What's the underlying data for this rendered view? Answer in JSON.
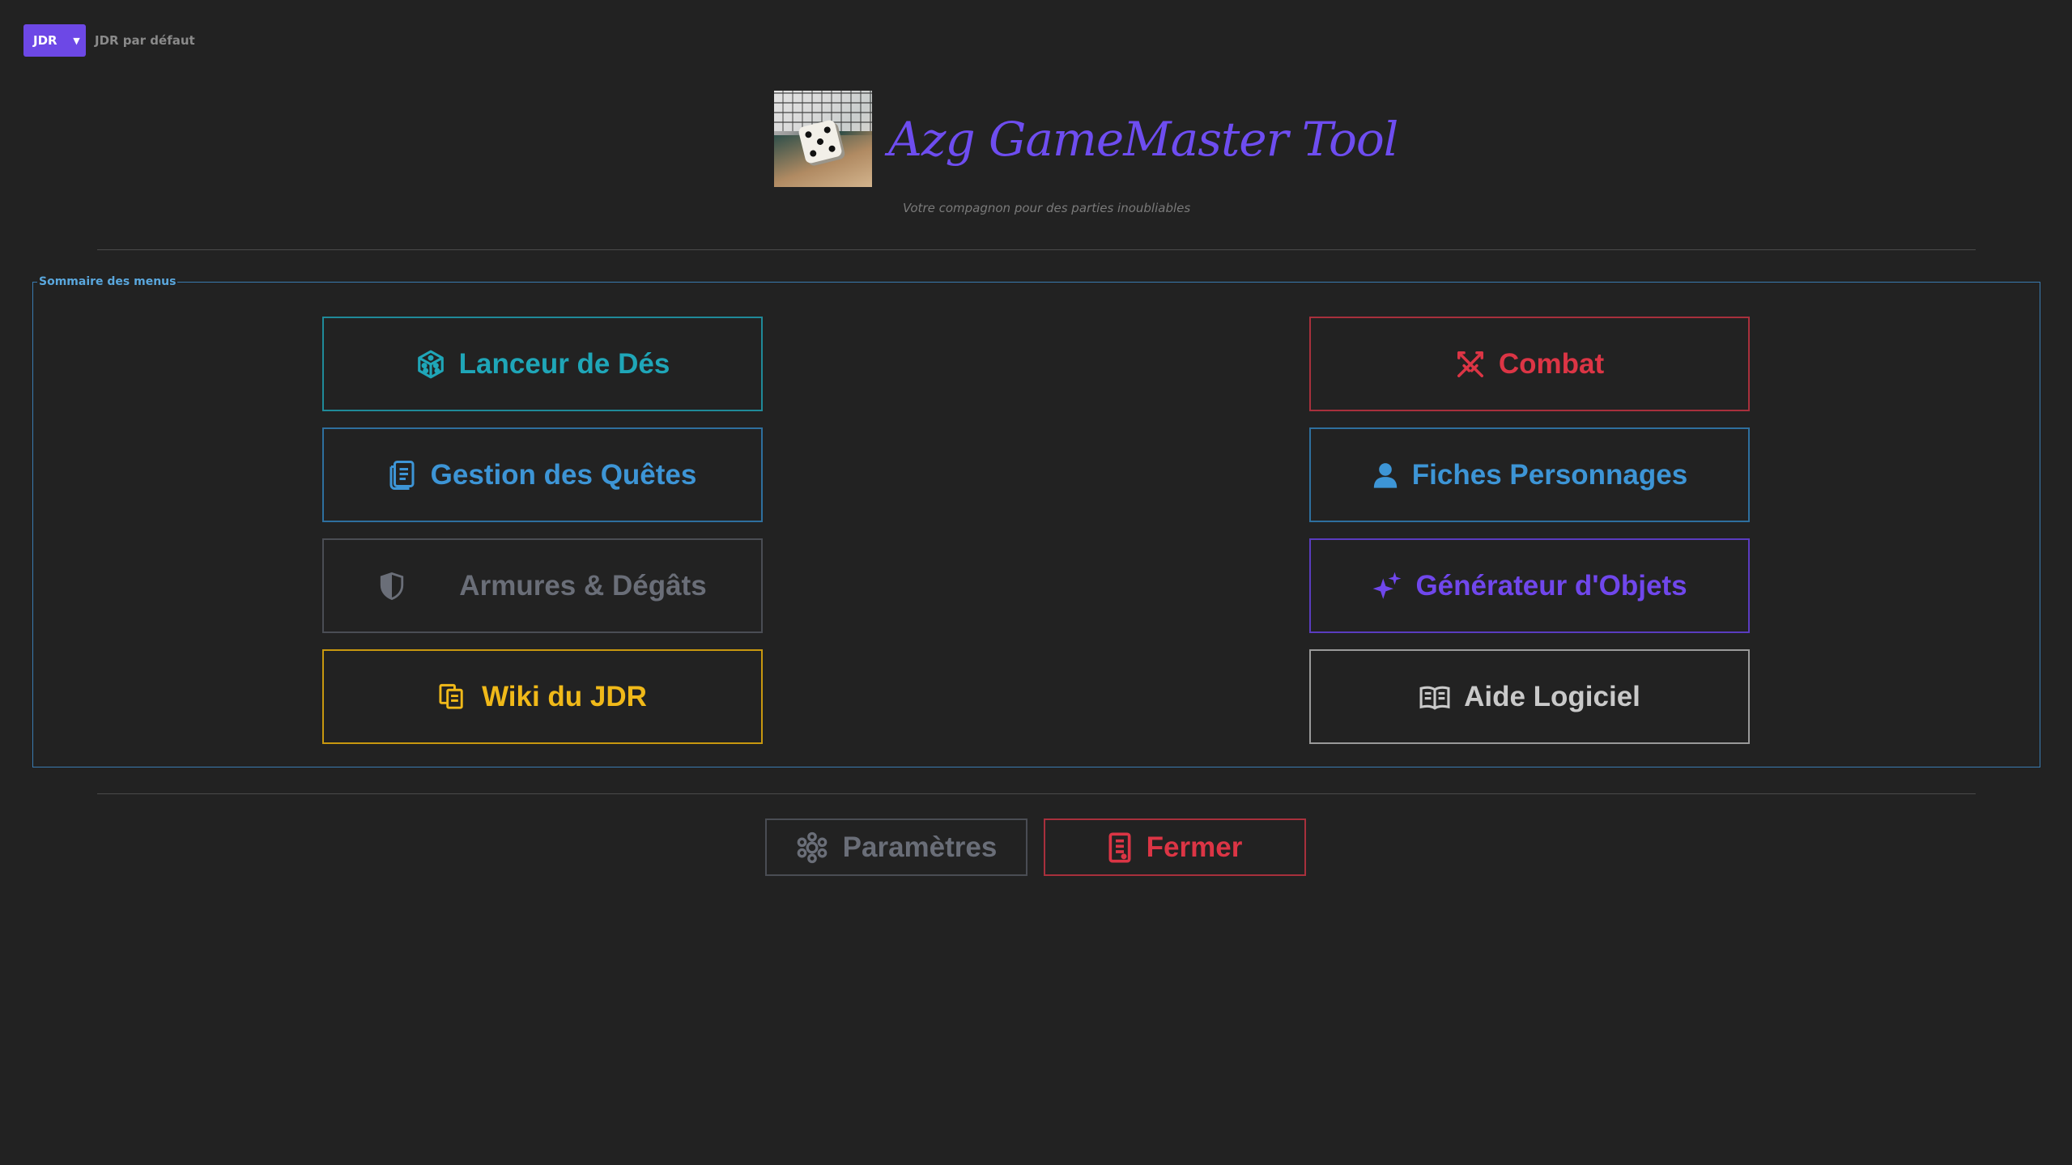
{
  "topbar": {
    "jdr_button_label": "JDR",
    "current_jdr": "JDR par défaut"
  },
  "header": {
    "title": "Azg GameMaster Tool",
    "subtitle": "Votre compagnon pour des parties inoubliables"
  },
  "summary": {
    "legend": "Sommaire des menus",
    "left_items": [
      {
        "label": "Lanceur de Dés",
        "icon": "dice-icon",
        "color": "#1fa6b8"
      },
      {
        "label": "Gestion des Quêtes",
        "icon": "scroll-icon",
        "color": "#3d95d6"
      },
      {
        "label": "Armures & Dégâts",
        "icon": "shield-icon",
        "color": "#6a6e78"
      },
      {
        "label": "Wiki du JDR",
        "icon": "pages-icon",
        "color": "#f0b919"
      }
    ],
    "right_items": [
      {
        "label": "Combat",
        "icon": "crossed-swords-icon",
        "color": "#dc3545"
      },
      {
        "label": "Fiches Personnages",
        "icon": "person-icon",
        "color": "#3d95d6"
      },
      {
        "label": "Générateur d'Objets",
        "icon": "sparkles-icon",
        "color": "#7047ec"
      },
      {
        "label": "Aide Logiciel",
        "icon": "book-icon",
        "color": "#c9c9c9"
      }
    ]
  },
  "footer": {
    "settings_label": "Paramètres",
    "close_label": "Fermer",
    "settings_color": "#6a6e78",
    "close_color": "#dc3545"
  }
}
